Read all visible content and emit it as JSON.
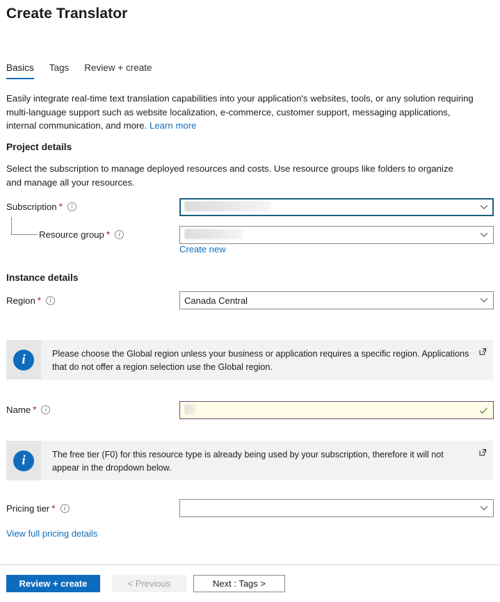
{
  "page": {
    "title": "Create Translator"
  },
  "tabs": [
    {
      "label": "Basics",
      "active": true
    },
    {
      "label": "Tags",
      "active": false
    },
    {
      "label": "Review + create",
      "active": false
    }
  ],
  "description": {
    "text": "Easily integrate real-time text translation capabilities into your application's websites, tools, or any solution requiring multi-language support such as website localization, e-commerce, customer support, messaging applications, internal communication, and more.",
    "link_label": "Learn more"
  },
  "project_details": {
    "heading": "Project details",
    "subtext": "Select the subscription to manage deployed resources and costs. Use resource groups like folders to organize and manage all your resources.",
    "subscription": {
      "label": "Subscription",
      "required": "*",
      "info_icon": "info-icon",
      "value": "",
      "redacted": true,
      "focused": true,
      "chevron_icon": "chevron-down-icon"
    },
    "resource_group": {
      "label": "Resource group",
      "required": "*",
      "info_icon": "info-icon",
      "value": "",
      "redacted": true,
      "chevron_icon": "chevron-down-icon",
      "create_new_label": "Create new"
    }
  },
  "instance_details": {
    "heading": "Instance details",
    "region": {
      "label": "Region",
      "required": "*",
      "info_icon": "info-icon",
      "value": "Canada Central",
      "chevron_icon": "chevron-down-icon"
    },
    "region_banner": {
      "icon": "info-circle-icon",
      "text": "Please choose the Global region unless your business or application requires a specific region. Applications that do not offer a region selection use the Global region.",
      "external_link_icon": "external-link-icon"
    },
    "name": {
      "label": "Name",
      "required": "*",
      "info_icon": "info-icon",
      "value": "",
      "redacted": true,
      "valid_icon": "checkmark-icon"
    },
    "tier_banner": {
      "icon": "info-circle-icon",
      "text": "The free tier (F0) for this resource type is already being used by your subscription, therefore it will not appear in the dropdown below.",
      "external_link_icon": "external-link-icon"
    },
    "pricing_tier": {
      "label": "Pricing tier",
      "required": "*",
      "info_icon": "info-icon",
      "value": "",
      "chevron_icon": "chevron-down-icon",
      "pricing_link_label": "View full pricing details"
    }
  },
  "footer": {
    "review_create_label": "Review + create",
    "previous_label": "< Previous",
    "next_label": "Next : Tags >"
  },
  "colors": {
    "accent": "#0f6cbd",
    "required": "#a4262c",
    "focus_border": "#17617f",
    "autofill_border": "#6f4b6f",
    "autofill_bg": "#fefde8",
    "valid_check": "#6a9a52",
    "banner_bg": "#f2f2f2",
    "banner_icon_bg": "#e6e6e6"
  }
}
